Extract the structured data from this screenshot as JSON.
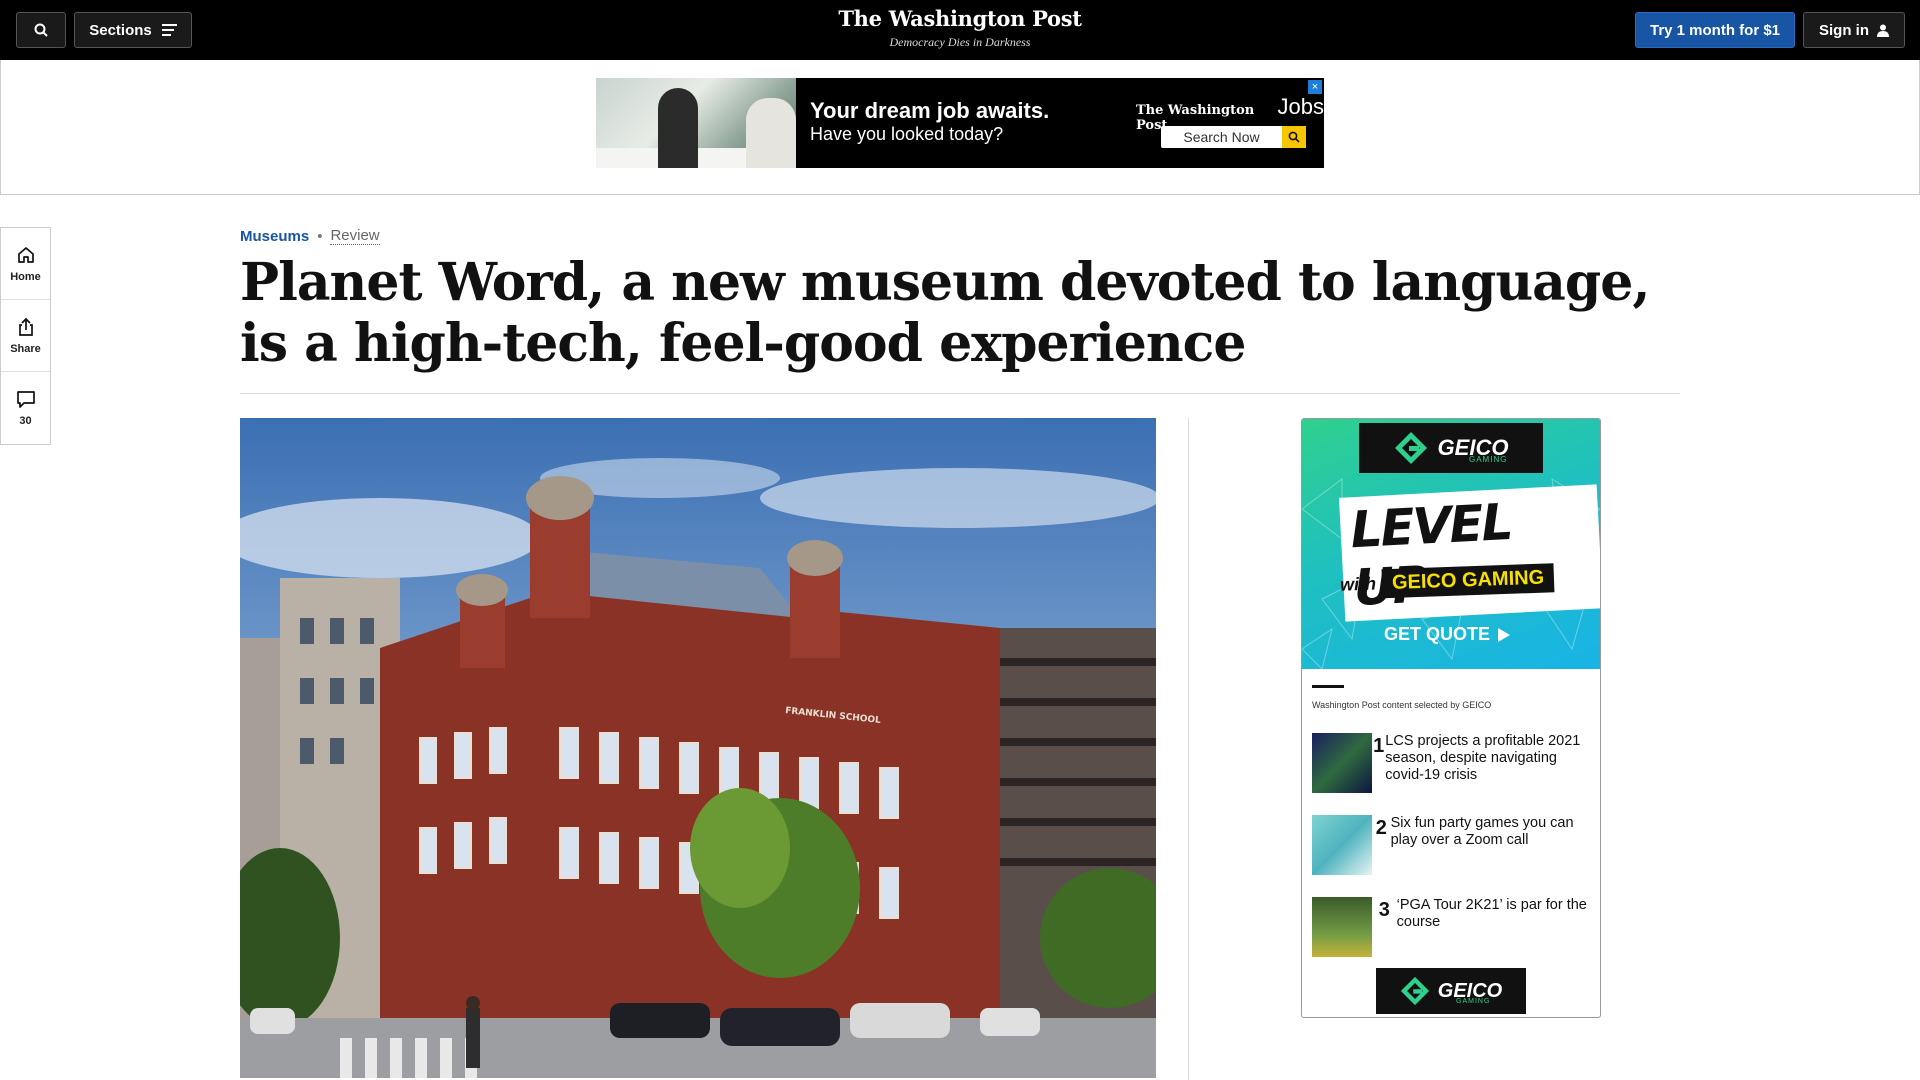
{
  "header": {
    "sections_label": "Sections",
    "logo_title": "The Washington Post",
    "logo_tagline": "Democracy Dies in Darkness",
    "try_label": "Try 1 month for $1",
    "signin_label": "Sign in",
    "colors": {
      "bar": "#000000",
      "accent": "#1955a5"
    }
  },
  "top_ad": {
    "headline": "Your dream job awaits.",
    "subline": "Have you looked today?",
    "brand": "The Washington Post",
    "brand_section": "Jobs",
    "search_label": "Search Now"
  },
  "left_rail": {
    "items": [
      {
        "label": "Home",
        "icon": "home-icon"
      },
      {
        "label": "Share",
        "icon": "share-icon"
      },
      {
        "label": "30",
        "icon": "comment-icon"
      }
    ]
  },
  "article": {
    "section": "Museums",
    "label": "Review",
    "headline": "Planet Word, a new museum devoted to language, is a high-tech, feel-good experience"
  },
  "hero_image": {
    "building_sign": "FRANKLIN SCHOOL"
  },
  "side_ad": {
    "brand": "GEICO",
    "brand_sub": "GAMING",
    "headline": "LEVEL UP",
    "with": "with",
    "brand_full": "GEICO GAMING",
    "cta": "GET QUOTE",
    "selected_by": "Washington Post content selected by GEICO",
    "stories": [
      {
        "num": "1",
        "title": "LCS projects a profitable 2021 season, despite navigating covid-19 crisis"
      },
      {
        "num": "2",
        "title": "Six fun party games you can play over a Zoom call"
      },
      {
        "num": "3",
        "title": "‘PGA Tour 2K21’ is par for the course"
      }
    ]
  }
}
